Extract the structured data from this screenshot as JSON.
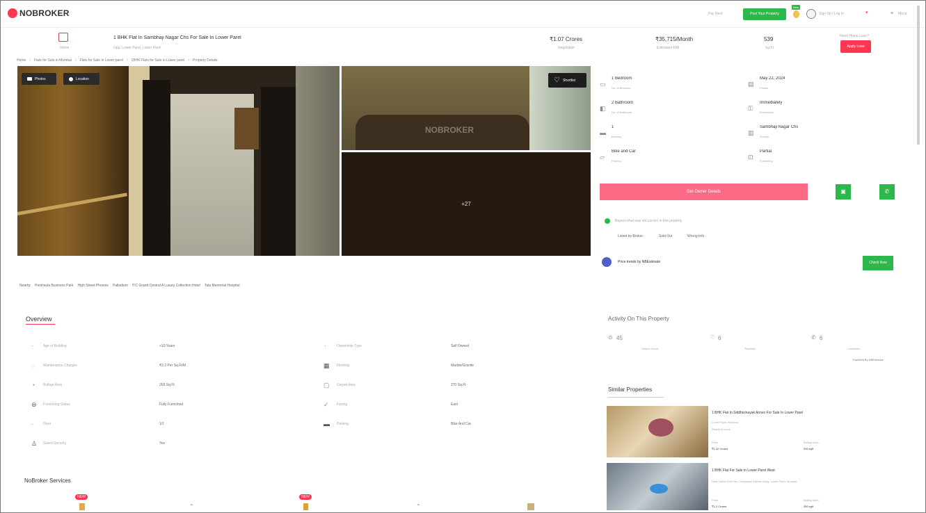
{
  "header": {
    "logo_text": "NOBROKER",
    "pay_rent": "Pay Rent",
    "post_property_label": "Post Your Property",
    "new_badge": "New",
    "user_name": "Sign Up / Log In",
    "menu_label": "Menu"
  },
  "property": {
    "title": "1 BHK Flat In Sambhaji Nagar Chs For Sale In Lower Parel",
    "subtitle": "Opp. Lower Parel, Lower Parel",
    "home_icon_label": "Home",
    "price": "₹1.07 Crores",
    "price_sub": "Negotiable",
    "emi": "₹35,715/Month",
    "emi_sub": "Estimated EMI",
    "area": "539",
    "area_sub": "Sq.Ft",
    "home_loan_text": "Need Home Loan?",
    "apply_loan_label": "Apply Loan"
  },
  "breadcrumb": [
    "Home",
    "Flats for Sale in Mumbai",
    "Flats for Sale in Lower parel",
    "1BHK Flats for Sale in Lower parel",
    "Property Details"
  ],
  "gallery": {
    "photos_label": "Photos",
    "location_label": "Location",
    "shortlist_label": "Shortlist",
    "watermark": "NOBROKER",
    "more_count": "+27"
  },
  "details": [
    {
      "value": "1 Bedroom",
      "label": "No. of Bedroom",
      "icon": "bed-icon"
    },
    {
      "value": "May 22, 2024",
      "label": "Posted",
      "icon": "calendar-icon"
    },
    {
      "value": "2 Bathroom",
      "label": "No. of Bathroom",
      "icon": "bath-icon"
    },
    {
      "value": "Immediately",
      "label": "Possession",
      "icon": "key-icon"
    },
    {
      "value": "1",
      "label": "Balcony",
      "icon": "balcony-icon"
    },
    {
      "value": "Sambhaji Nagar Chs",
      "label": "Society",
      "icon": "building-icon"
    },
    {
      "value": "Bike and Car",
      "label": "Parking",
      "icon": "car-icon"
    },
    {
      "value": "Partial",
      "label": "Furnishing",
      "icon": "sofa-icon"
    }
  ],
  "actions": {
    "owner_details_label": "Get Owner Details",
    "report_text": "Report what was not correct in this property",
    "report_tags": [
      "Listed by Broker",
      "Sold Out",
      "Wrong Info"
    ],
    "price_trends_text": "Price trends by NBEstimate",
    "check_now_label": "Check Now"
  },
  "nearby": {
    "label": "Nearby",
    "places": [
      "Peninsula Business Park",
      "High Street Phoenix",
      "Palladium",
      "ITC Grand Central A Luxury Collection Hotel",
      "Tata Memorial Hospital"
    ]
  },
  "overview": {
    "title": "Overview",
    "items": [
      {
        "label": "Age of Building",
        "value": ">10 Years",
        "icon": "building-age-icon"
      },
      {
        "label": "Ownership Type",
        "value": "Self Owned",
        "icon": "ownership-icon"
      },
      {
        "label": "Maintenance Charges",
        "value": "₹3.2 Per Sq.Ft/M",
        "icon": "maintenance-icon"
      },
      {
        "label": "Flooring",
        "value": "Marble/Granite",
        "icon": "flooring-icon"
      },
      {
        "label": "Builtup Area",
        "value": "269 Sq.Ft",
        "icon": "builtup-icon"
      },
      {
        "label": "Carpet Area",
        "value": "270 Sq.Ft",
        "icon": "carpet-icon"
      },
      {
        "label": "Furnishing Status",
        "value": "Fully Furnished",
        "icon": "furnishing-icon"
      },
      {
        "label": "Facing",
        "value": "East",
        "icon": "compass-icon"
      },
      {
        "label": "Floor",
        "value": "1/1",
        "icon": "floor-icon"
      },
      {
        "label": "Parking",
        "value": "Bike And Car",
        "icon": "parking-icon"
      },
      {
        "label": "Gated Security",
        "value": "Yes",
        "icon": "security-icon"
      }
    ]
  },
  "activity": {
    "title": "Activity On This Property",
    "stats": [
      {
        "value": "45",
        "label": "Unique Views",
        "icon": "eye-icon"
      },
      {
        "value": "6",
        "label": "Shortlists",
        "icon": "heart-icon"
      },
      {
        "value": "6",
        "label": "Contacted",
        "icon": "phone-icon"
      }
    ],
    "powered": "Powered By NBEstimate"
  },
  "similar": {
    "title": "Similar Properties",
    "items": [
      {
        "title": "1 BHK Flat In Siddhivinayak Annex For Sale In Lower Parel",
        "sub": "Lower Parel, Mumbai",
        "sub2": "Ready to move",
        "price_label": "Price",
        "price": "₹1.42 Crores",
        "area_label": "Builtup Area",
        "area": "530 sqft"
      },
      {
        "title": "1 BHK Flat For Sale In Lower Parel West",
        "sub": "Near Dainik Shiv Ner, Ganpatrao Kadam Marg, Lower Parel, Mumbai",
        "sub2": "",
        "price_label": "Price",
        "price": "₹1.2 Crores",
        "area_label": "Builtup Area",
        "area": "350 sqft"
      }
    ]
  },
  "services": {
    "title": "NoBroker Services",
    "badges": [
      "NEW",
      "NEW"
    ]
  }
}
